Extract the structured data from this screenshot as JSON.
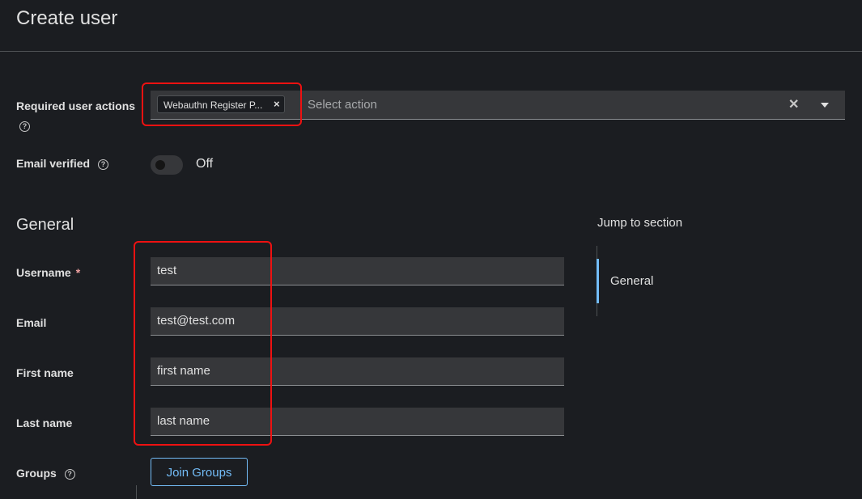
{
  "page": {
    "title": "Create user"
  },
  "required_actions": {
    "label": "Required user actions",
    "help_icon": "help-circle-icon",
    "chip_label": "Webauthn Register P...",
    "chip_close": "×",
    "placeholder": "Select action",
    "clear": "✕"
  },
  "email_verified": {
    "label": "Email verified",
    "toggle_text": "Off"
  },
  "general": {
    "title": "General",
    "username": {
      "label": "Username",
      "required_mark": "*",
      "value": "test"
    },
    "email": {
      "label": "Email",
      "value": "test@test.com"
    },
    "first_name": {
      "label": "First name",
      "value": "first name"
    },
    "last_name": {
      "label": "Last name",
      "value": "last name"
    },
    "groups": {
      "label": "Groups",
      "button": "Join Groups"
    }
  },
  "jump": {
    "title": "Jump to section",
    "items": [
      "General"
    ]
  },
  "colors": {
    "accent": "#73bcf7",
    "annotation": "#ee1111",
    "background": "#1b1d21"
  }
}
